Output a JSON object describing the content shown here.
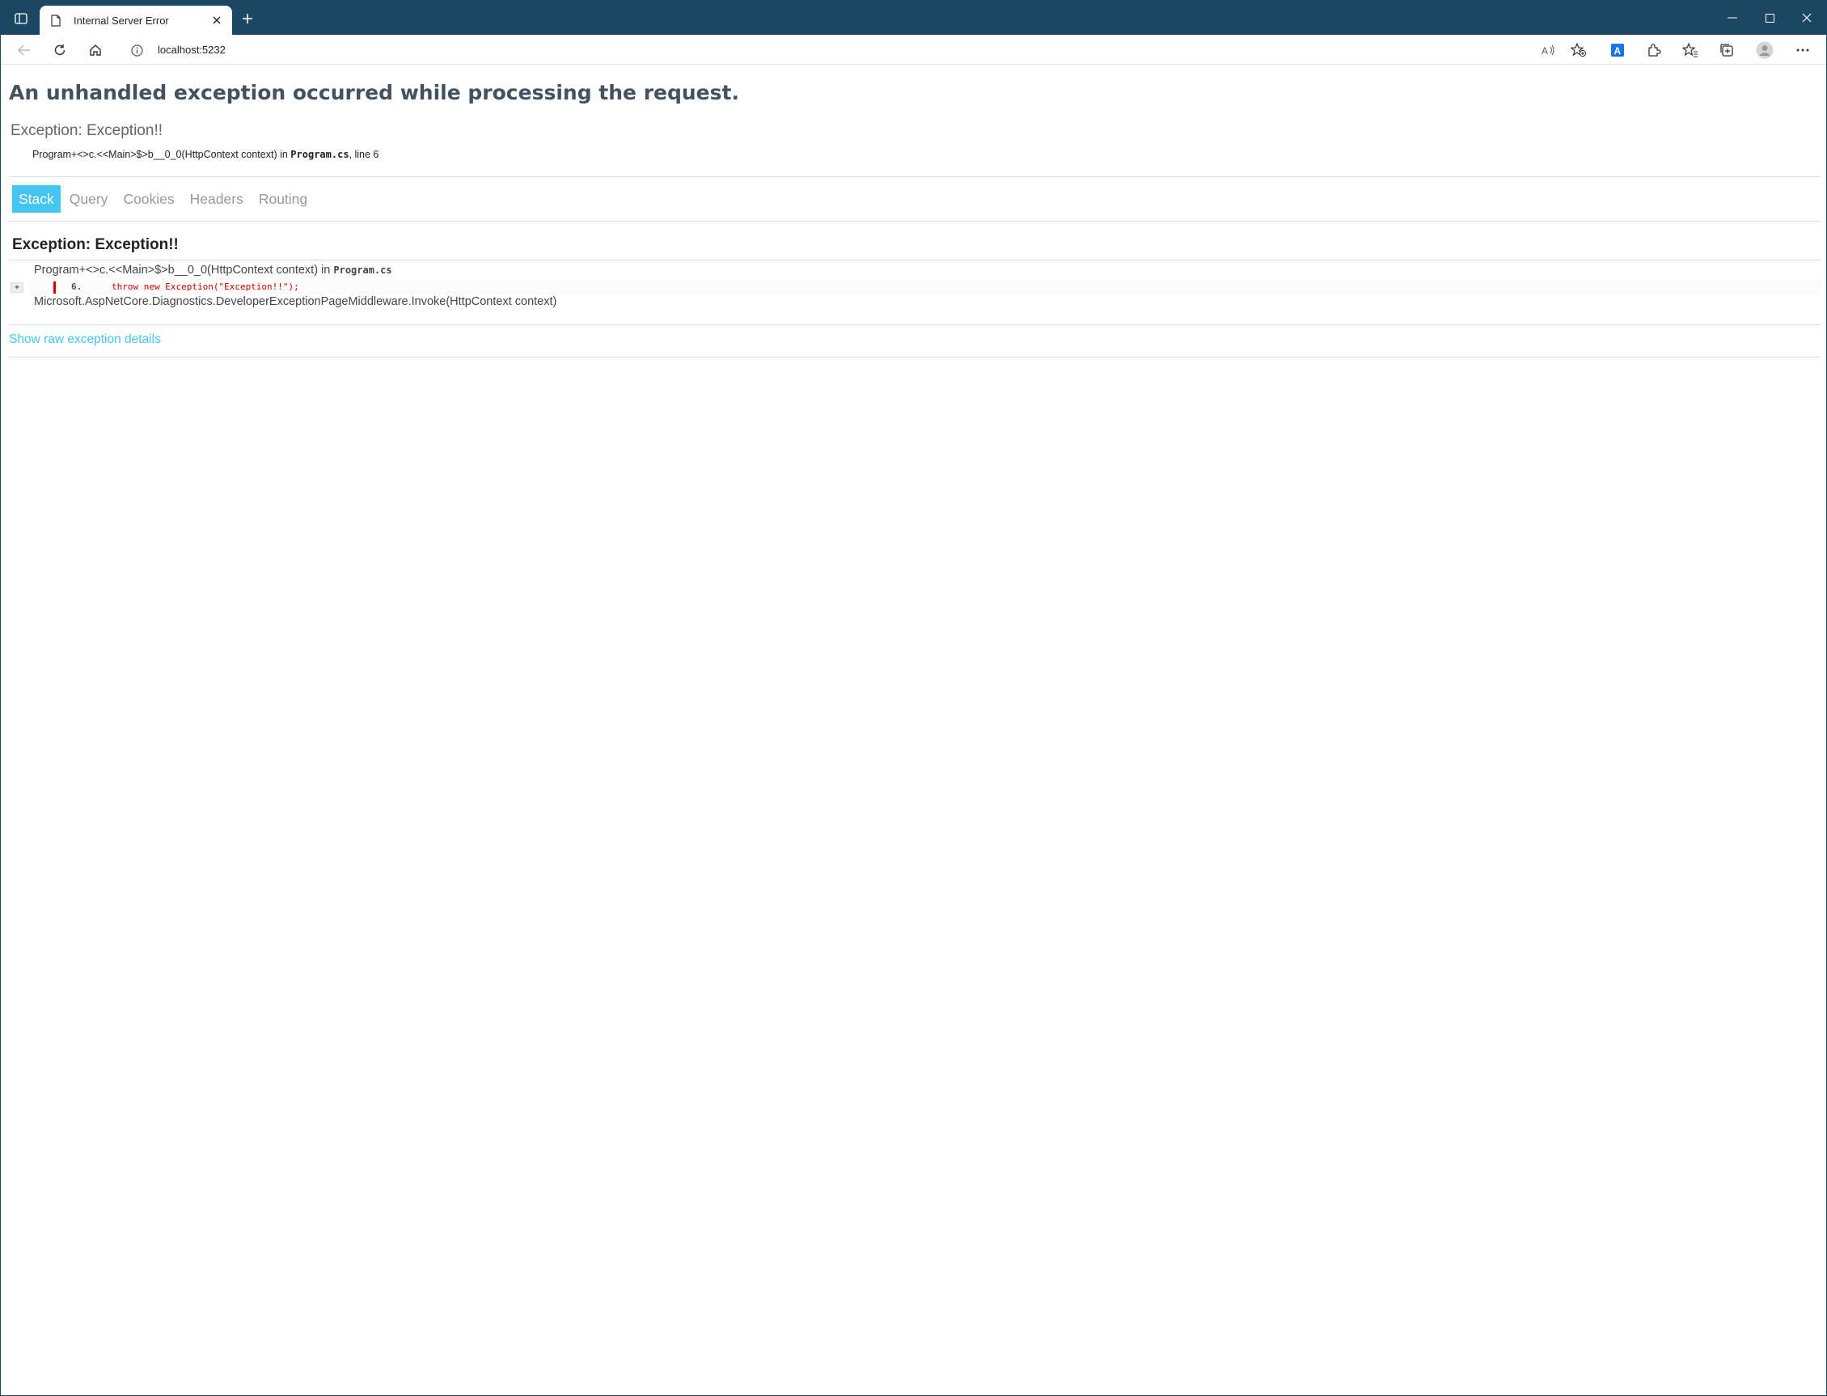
{
  "browser": {
    "tab_title": "Internal Server Error",
    "url": "localhost:5232",
    "accent_color": "#1c4763",
    "icons": {
      "tab_actions": "tab-actions-icon",
      "tab_favicon": "document-icon",
      "tab_close": "close-icon",
      "new_tab": "plus-icon",
      "minimize": "minimize-icon",
      "maximize": "maximize-icon",
      "close_window": "close-icon",
      "back": "back-arrow-icon",
      "refresh": "refresh-icon",
      "home": "home-icon",
      "site_info": "info-icon",
      "read_aloud": "read-aloud-icon",
      "favorite": "add-favorite-icon",
      "translator": "translator-icon",
      "extensions": "extensions-icon",
      "favorites": "favorites-icon",
      "collections": "collections-icon",
      "profile": "profile-icon",
      "more": "more-icon"
    }
  },
  "page": {
    "heading": "An unhandled exception occurred while processing the request.",
    "title_error": "Exception: Exception!!",
    "location": {
      "method": "Program+<>c.<<Main>$>b__0_0(HttpContext context) in ",
      "file": "Program.cs",
      "line_text": ", line 6"
    },
    "tabs": [
      {
        "label": "Stack",
        "selected": true
      },
      {
        "label": "Query",
        "selected": false
      },
      {
        "label": "Cookies",
        "selected": false
      },
      {
        "label": "Headers",
        "selected": false
      },
      {
        "label": "Routing",
        "selected": false
      }
    ],
    "tab_selected_color": "#44c5f2",
    "exception": {
      "heading": "Exception: Exception!!",
      "frames": [
        {
          "method": "Program+<>c.<<Main>$>b__0_0(HttpContext context) in ",
          "file": "Program.cs"
        },
        {
          "method": "Microsoft.AspNetCore.Diagnostics.DeveloperExceptionPageMiddleware.Invoke(HttpContext context)",
          "file": ""
        }
      ],
      "expander": "+",
      "code_line": {
        "number": "6.",
        "code": "throw new Exception(\"Exception!!\");"
      }
    },
    "raw_link": "Show raw exception details"
  }
}
